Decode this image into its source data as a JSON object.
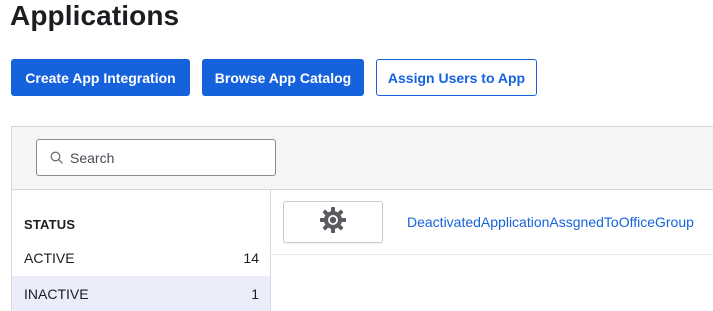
{
  "page": {
    "title": "Applications"
  },
  "toolbar": {
    "create_label": "Create App Integration",
    "browse_label": "Browse App Catalog",
    "assign_label": "Assign Users to App"
  },
  "search": {
    "placeholder": "Search",
    "value": ""
  },
  "sidebar": {
    "heading": "STATUS",
    "filters": [
      {
        "label": "ACTIVE",
        "count": "14"
      },
      {
        "label": "INACTIVE",
        "count": "1",
        "selected": true
      }
    ]
  },
  "apps": [
    {
      "name": "DeactivatedApplicationAssgnedToOfficeGroup",
      "icon": "gear-icon"
    }
  ],
  "colors": {
    "primary": "#1662dd",
    "selected_row": "#ebeefa",
    "header_bg": "#f5f5f6"
  }
}
